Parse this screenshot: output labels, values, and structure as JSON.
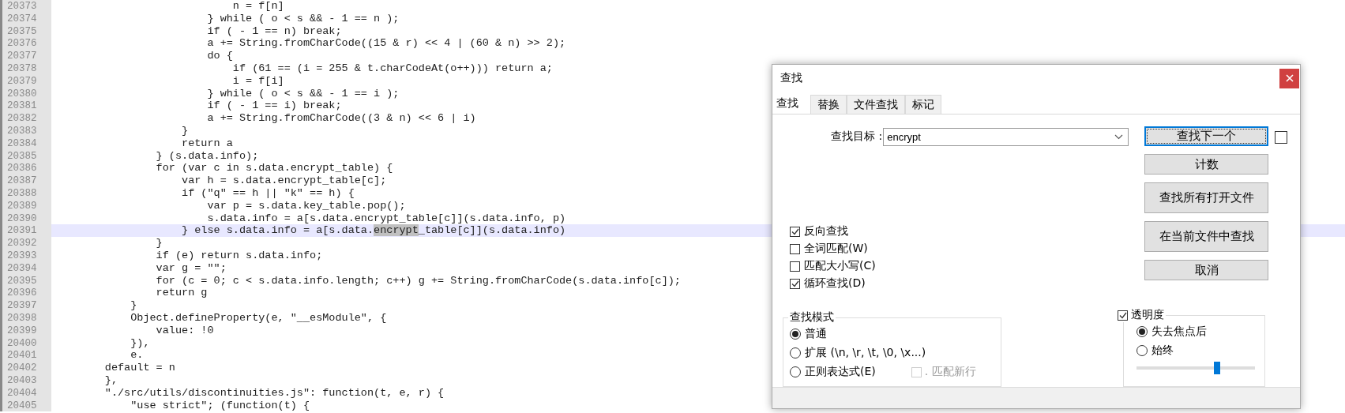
{
  "editor": {
    "lines": [
      {
        "number": "20373",
        "text": "                            n = f[n]",
        "current": false
      },
      {
        "number": "20374",
        "text": "                        } while ( o < s && - 1 == n );",
        "current": false
      },
      {
        "number": "20375",
        "text": "                        if ( - 1 == n) break;",
        "current": false
      },
      {
        "number": "20376",
        "text": "                        a += String.fromCharCode((15 & r) << 4 | (60 & n) >> 2);",
        "current": false
      },
      {
        "number": "20377",
        "text": "                        do {",
        "current": false
      },
      {
        "number": "20378",
        "text": "                            if (61 == (i = 255 & t.charCodeAt(o++))) return a;",
        "current": false
      },
      {
        "number": "20379",
        "text": "                            i = f[i]",
        "current": false
      },
      {
        "number": "20380",
        "text": "                        } while ( o < s && - 1 == i );",
        "current": false
      },
      {
        "number": "20381",
        "text": "                        if ( - 1 == i) break;",
        "current": false
      },
      {
        "number": "20382",
        "text": "                        a += String.fromCharCode((3 & n) << 6 | i)",
        "current": false
      },
      {
        "number": "20383",
        "text": "                    }",
        "current": false
      },
      {
        "number": "20384",
        "text": "                    return a",
        "current": false
      },
      {
        "number": "20385",
        "text": "                } (s.data.info);",
        "current": false
      },
      {
        "number": "20386",
        "text": "                for (var c in s.data.encrypt_table) {",
        "current": false
      },
      {
        "number": "20387",
        "text": "                    var h = s.data.encrypt_table[c];",
        "current": false
      },
      {
        "number": "20388",
        "text": "                    if (\"q\" == h || \"k\" == h) {",
        "current": false
      },
      {
        "number": "20389",
        "text": "                        var p = s.data.key_table.pop();",
        "current": false
      },
      {
        "number": "20390",
        "text": "                        s.data.info = a[s.data.encrypt_table[c]](s.data.info, p)",
        "current": false
      },
      {
        "number": "20391",
        "parts": [
          {
            "text": "                    } else s.data.info = a[s.data.",
            "highlighted": false
          },
          {
            "text": "encrypt",
            "highlighted": true
          },
          {
            "text": "_table[c]](s.data.info)",
            "highlighted": false
          }
        ],
        "current": true
      },
      {
        "number": "20392",
        "text": "                }",
        "current": false
      },
      {
        "number": "20393",
        "text": "                if (e) return s.data.info;",
        "current": false
      },
      {
        "number": "20394",
        "text": "                var g = \"\";",
        "current": false
      },
      {
        "number": "20395",
        "text": "                for (c = 0; c < s.data.info.length; c++) g += String.fromCharCode(s.data.info[c]);",
        "current": false
      },
      {
        "number": "20396",
        "text": "                return g",
        "current": false
      },
      {
        "number": "20397",
        "text": "            }",
        "current": false
      },
      {
        "number": "20398",
        "text": "            Object.defineProperty(e, \"__esModule\", {",
        "current": false
      },
      {
        "number": "20399",
        "text": "                value: !0",
        "current": false
      },
      {
        "number": "20400",
        "text": "            }),",
        "current": false
      },
      {
        "number": "20401",
        "text": "            e.",
        "current": false
      },
      {
        "number": "20402",
        "text": "        default = n",
        "current": false
      },
      {
        "number": "20403",
        "text": "        },",
        "current": false
      },
      {
        "number": "20404",
        "text": "        \"./src/utils/discontinuities.js\": function(t, e, r) {",
        "current": false
      },
      {
        "number": "20405",
        "text": "            \"use strict\"; (function(t) {",
        "current": false
      }
    ]
  },
  "find_dialog": {
    "title": "查找",
    "tabs": [
      {
        "label": "查找",
        "selected": true
      },
      {
        "label": "替换",
        "selected": false
      },
      {
        "label": "文件查找",
        "selected": false
      },
      {
        "label": "标记",
        "selected": false
      }
    ],
    "search_label": "查找目标 :",
    "search_value": "encrypt",
    "buttons": [
      {
        "label": "查找下一个",
        "focused": true,
        "tall": false
      },
      {
        "label": "计数",
        "focused": false,
        "tall": false
      },
      {
        "label": "查找所有打开文件",
        "focused": false,
        "tall": true
      },
      {
        "label": "在当前文件中查找",
        "focused": false,
        "tall": true
      },
      {
        "label": "取消",
        "focused": false,
        "tall": false
      }
    ],
    "side_checkbox": {
      "checked": false
    },
    "options": [
      {
        "label": "反向查找",
        "checked": true
      },
      {
        "label": "全词匹配(W)",
        "checked": false
      },
      {
        "label": "匹配大小写(C)",
        "checked": false
      },
      {
        "label": "循环查找(D)",
        "checked": true
      }
    ],
    "search_mode": {
      "title": "查找模式",
      "options": [
        {
          "label": "普通",
          "selected": true
        },
        {
          "label": "扩展 (\\n, \\r, \\t, \\0, \\x...)",
          "selected": false
        },
        {
          "label": "正则表达式(E)",
          "selected": false
        }
      ],
      "newline_option": {
        "label": ". 匹配新行",
        "checked": false,
        "disabled": true
      }
    },
    "transparency": {
      "label": "透明度",
      "checked": true,
      "options": [
        {
          "label": "失去焦点后",
          "selected": true
        },
        {
          "label": "始终",
          "selected": false
        }
      ],
      "level": 0.68
    }
  }
}
